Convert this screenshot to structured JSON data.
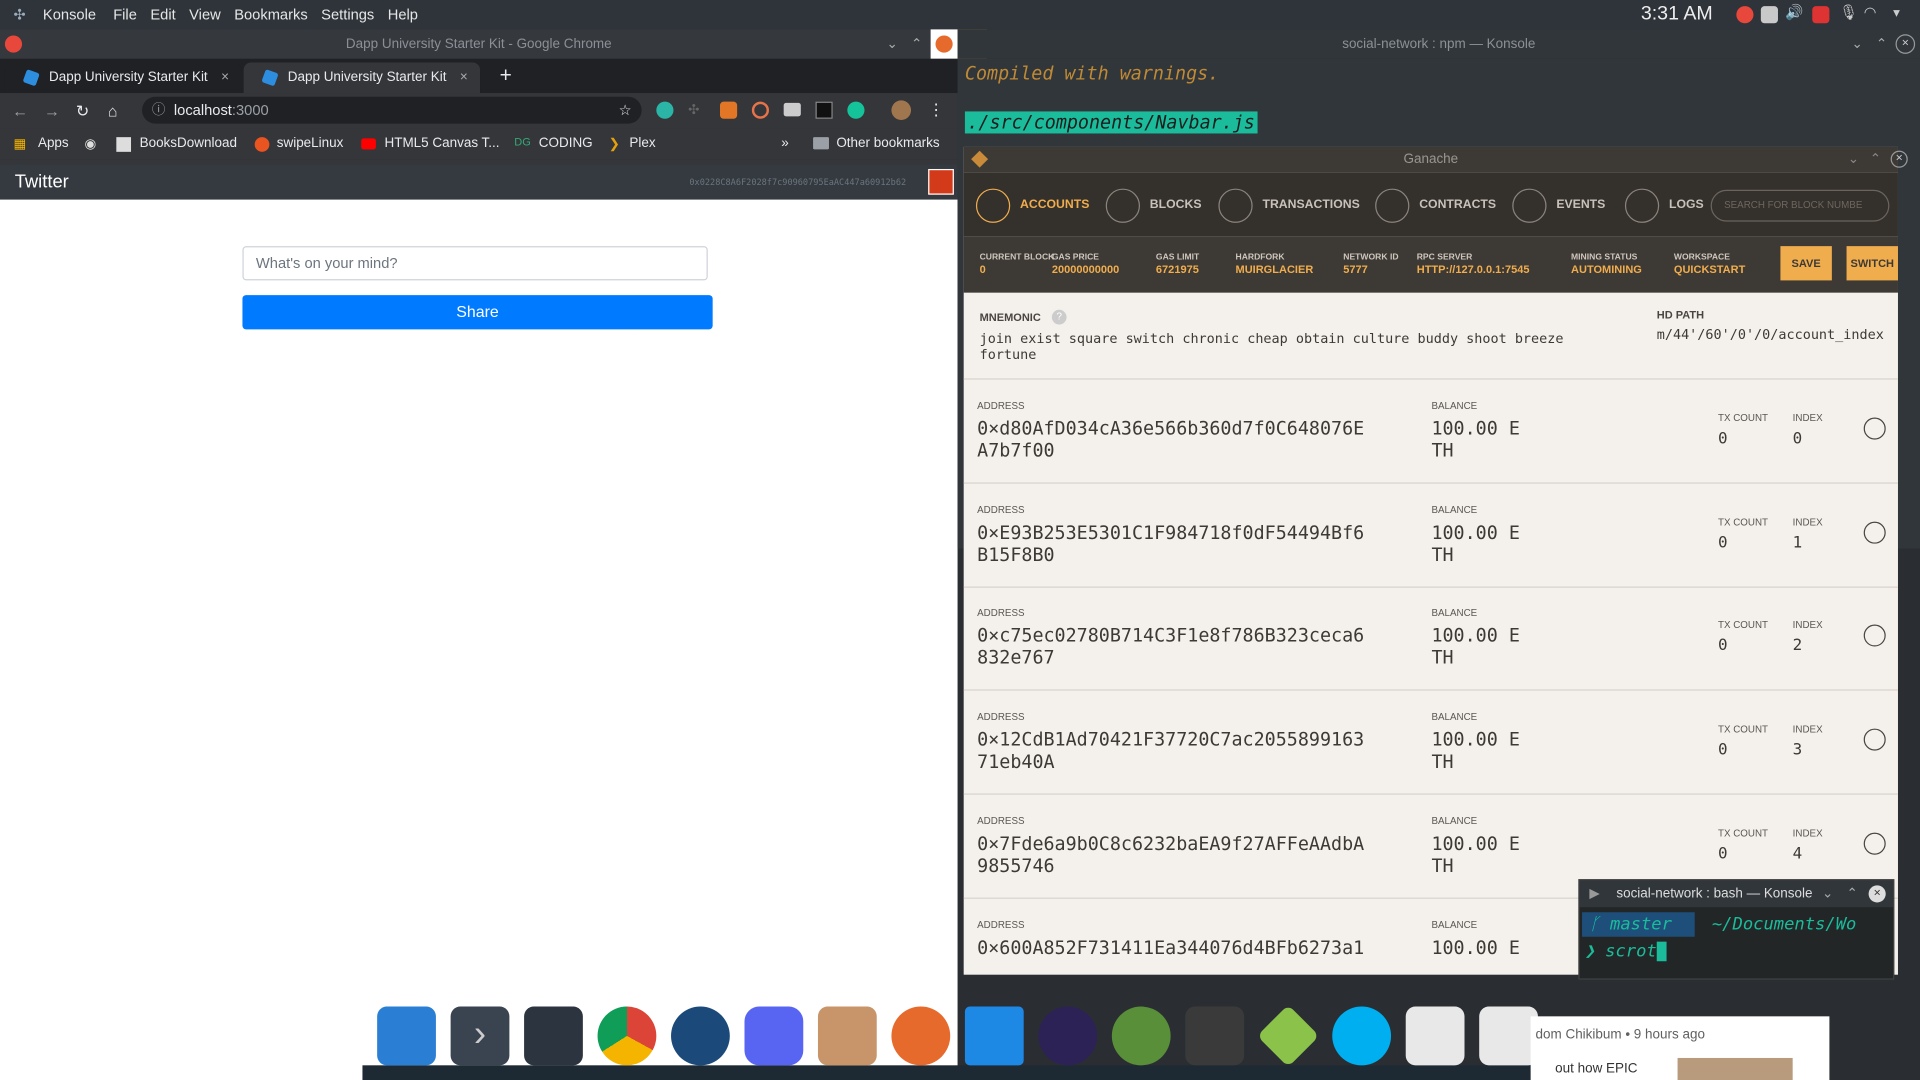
{
  "panel": {
    "menu": [
      "Konsole",
      "File",
      "Edit",
      "View",
      "Bookmarks",
      "Settings",
      "Help"
    ],
    "clock": "3:31 AM"
  },
  "chrome": {
    "window_title": "Dapp University Starter Kit - Google Chrome",
    "tabs": [
      {
        "label": "Dapp University Starter Kit"
      },
      {
        "label": "Dapp University Starter Kit"
      }
    ],
    "url_host": "localhost",
    "url_port": ":3000",
    "bookmarks": [
      "Apps",
      "BooksDownload",
      "swipeLinux",
      "HTML5 Canvas T...",
      "CODING",
      "Plex",
      "Other bookmarks"
    ]
  },
  "dapp": {
    "brand": "Twitter",
    "account": "0x0228C8A6F2028f7c90960795EaAC447a60912b62",
    "post_placeholder": "What's on your mind?",
    "share_label": "Share"
  },
  "konsole": {
    "title": "social-network : npm — Konsole",
    "warning": "Compiled with warnings.",
    "file": "./src/components/Navbar.js"
  },
  "ganache": {
    "title": "Ganache",
    "nav": [
      "ACCOUNTS",
      "BLOCKS",
      "TRANSACTIONS",
      "CONTRACTS",
      "EVENTS",
      "LOGS"
    ],
    "search_placeholder": "SEARCH FOR BLOCK NUMBE",
    "stats": [
      {
        "label": "CURRENT BLOCK",
        "value": "0"
      },
      {
        "label": "GAS PRICE",
        "value": "20000000000"
      },
      {
        "label": "GAS LIMIT",
        "value": "6721975"
      },
      {
        "label": "HARDFORK",
        "value": "MUIRGLACIER"
      },
      {
        "label": "NETWORK ID",
        "value": "5777"
      },
      {
        "label": "RPC SERVER",
        "value": "HTTP://127.0.0.1:7545"
      },
      {
        "label": "MINING STATUS",
        "value": "AUTOMINING"
      },
      {
        "label": "WORKSPACE",
        "value": "QUICKSTART"
      }
    ],
    "save_label": "SAVE",
    "switch_label": "SWITCH",
    "mnemonic_label": "MNEMONIC",
    "mnemonic_line1": "join exist square switch chronic cheap obtain culture buddy shoot breeze",
    "mnemonic_line2": "fortune",
    "hdpath_label": "HD PATH",
    "hdpath": "m/44'/60'/0'/0/account_index",
    "address_label": "ADDRESS",
    "balance_label": "BALANCE",
    "txcount_label": "TX COUNT",
    "index_label": "INDEX",
    "accounts": [
      {
        "addr1": "0×d80AfD034cA36e566b360d7f0C648076E",
        "addr2": "A7b7f00",
        "bal1": "100.00 E",
        "bal2": "TH",
        "tx": "0",
        "index": "0"
      },
      {
        "addr1": "0×E93B253E5301C1F984718f0dF54494Bf6",
        "addr2": "B15F8B0",
        "bal1": "100.00 E",
        "bal2": "TH",
        "tx": "0",
        "index": "1"
      },
      {
        "addr1": "0×c75ec02780B714C3F1e8f786B323ceca6",
        "addr2": "832e767",
        "bal1": "100.00 E",
        "bal2": "TH",
        "tx": "0",
        "index": "2"
      },
      {
        "addr1": "0×12CdB1Ad70421F37720C7ac2055899163",
        "addr2": "71eb40A",
        "bal1": "100.00 E",
        "bal2": "TH",
        "tx": "0",
        "index": "3"
      },
      {
        "addr1": "0×7Fde6a9b0C8c6232baEA9f27AFFeAAdbA",
        "addr2": "9855746",
        "bal1": "100.00 E",
        "bal2": "TH",
        "tx": "0",
        "index": "4"
      },
      {
        "addr1": "0×600A852F731411Ea344076d4BFb6273a1",
        "addr2": "",
        "bal1": "100.00 E",
        "bal2": "",
        "tx": "",
        "index": ""
      }
    ]
  },
  "bash": {
    "title": "social-network : bash — Konsole",
    "branch": "master",
    "path": "~/Documents/Wo",
    "command": "scrot"
  },
  "youtube": {
    "meta": "dom Chikibum • 9 hours ago",
    "text": "out how EPIC"
  }
}
